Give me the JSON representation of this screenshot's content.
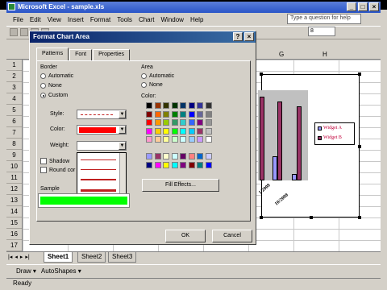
{
  "window": {
    "title": "Microsoft Excel - sample.xls",
    "min": "_",
    "max": "□",
    "close": "×"
  },
  "menu": [
    "File",
    "Edit",
    "View",
    "Insert",
    "Format",
    "Tools",
    "Chart",
    "Window",
    "Help"
  ],
  "ask_placeholder": "Type a question for help",
  "font_size": "8",
  "columns": [
    "G",
    "H"
  ],
  "rows": [
    "1",
    "2",
    "3",
    "4",
    "5",
    "6",
    "7",
    "8",
    "9",
    "10",
    "11",
    "12",
    "13",
    "14",
    "15",
    "16",
    "17"
  ],
  "chart": {
    "legend": [
      "Widget A",
      "Widget B"
    ],
    "x_labels": [
      "1/2008",
      "10/2008"
    ],
    "colors": {
      "widget_a": "#9999ff",
      "widget_b": "#993366"
    }
  },
  "dialog": {
    "title": "Format Chart Area",
    "help": "?",
    "close": "×",
    "tabs": [
      "Patterns",
      "Font",
      "Properties"
    ],
    "border": {
      "heading": "Border",
      "options": [
        "Automatic",
        "None",
        "Custom"
      ],
      "selected": "Custom",
      "style_label": "Style:",
      "color_label": "Color:",
      "weight_label": "Weight:",
      "color_value": "#ff0000"
    },
    "shadow": "Shadow",
    "round_corners": "Round cor",
    "sample_label": "Sample",
    "sample_color": "#00ff00",
    "area": {
      "heading": "Area",
      "options": [
        "Automatic",
        "None"
      ],
      "color_label": "Color:",
      "fill_effects": "Fill Effects..."
    },
    "ok": "OK",
    "cancel": "Cancel"
  },
  "sheet_tabs": [
    "Sheet1",
    "Sheet2",
    "Sheet3"
  ],
  "active_tab": "Sheet1",
  "draw": {
    "label": "Draw ▾",
    "autoshapes": "AutoShapes ▾"
  },
  "status": "Ready"
}
